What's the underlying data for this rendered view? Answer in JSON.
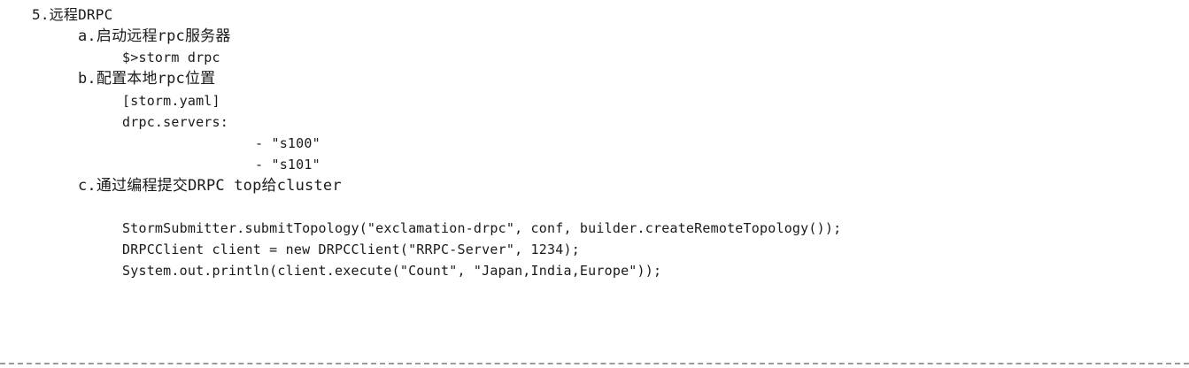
{
  "section": {
    "heading": "5.远程DRPC",
    "steps": [
      {
        "label": "a.启动远程rpc服务器",
        "lines": [
          "$>storm drpc"
        ]
      },
      {
        "label": "b.配置本地rpc位置",
        "lines": [
          "[storm.yaml]",
          "drpc.servers:",
          "- \"s100\"",
          "- \"s101\""
        ]
      },
      {
        "label": "c.通过编程提交DRPC top给cluster",
        "lines": [
          "StormSubmitter.submitTopology(\"exclamation-drpc\", conf, builder.createRemoteTopology());",
          "DRPCClient client = new DRPCClient(\"RRPC-Server\", 1234);",
          "System.out.println(client.execute(\"Count\", \"Japan,India,Europe\"));"
        ]
      }
    ]
  }
}
